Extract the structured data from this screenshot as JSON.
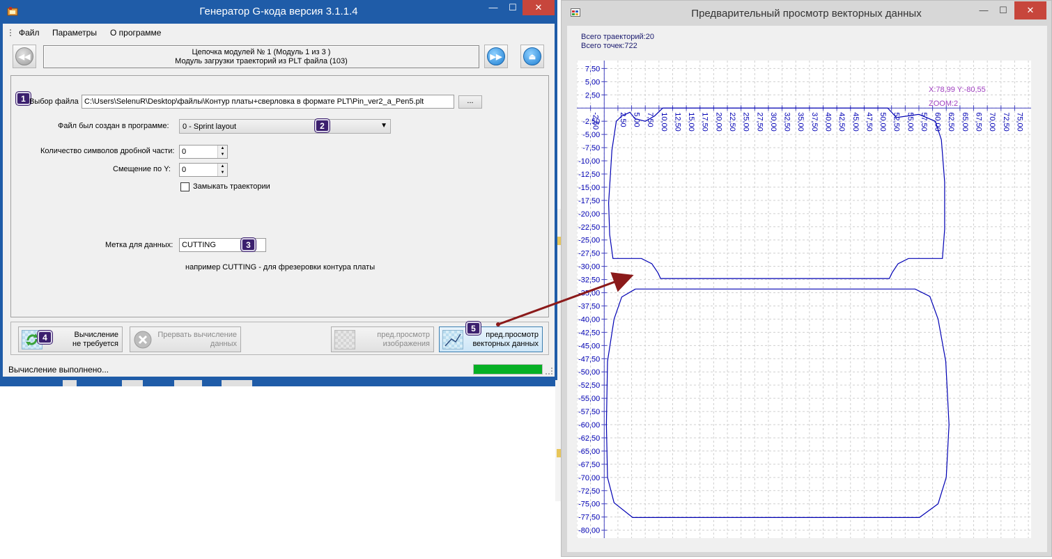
{
  "main_window": {
    "title": "Генератор G-кода версия 3.1.1.4",
    "controls": {
      "minimize": "—",
      "maximize": "☐",
      "close": "✕"
    },
    "menu": [
      "Файл",
      "Параметры",
      "О программе"
    ],
    "chain": {
      "line1": "Цепочка модулей № 1 (Модуль 1 из 3 )",
      "line2": "Модуль загрузки траекторий из PLT файла (103)"
    },
    "form": {
      "file_label": "Выбор файла",
      "file_path": "C:\\Users\\SelenuR\\Desktop\\файлы\\Контур платы+сверловка в формате PLT\\Pin_ver2_a_Pen5.plt",
      "browse_label": "...",
      "program_label": "Файл был создан в программе:",
      "program_value": "0 - Sprint layout",
      "decimals_label": "Количество символов дробной части:",
      "decimals_value": "0",
      "offset_label": "Смещение по Y:",
      "offset_value": "0",
      "close_paths_label": "Замыкать траектории",
      "close_paths_checked": false,
      "data_tag_label": "Метка для данных:",
      "data_tag_value": "CUTTING",
      "hint": "например CUTTING - для фрезеровки контура платы"
    },
    "badges": [
      "1",
      "2",
      "3",
      "4",
      "5"
    ],
    "buttons": {
      "compute": {
        "line1": "Вычисление",
        "line2": "не требуется"
      },
      "abort": {
        "line1": "Прервать вычисление",
        "line2": "данных"
      },
      "preview_image": {
        "line1": "пред.просмотр",
        "line2": "изображения"
      },
      "preview_vector": {
        "line1": "пред.просмотр",
        "line2": "векторных данных"
      }
    },
    "status": "Вычисление выполнено...",
    "progress_fraction": 1.0
  },
  "preview_window": {
    "title": "Предварительный просмотр векторных данных",
    "controls": {
      "minimize": "—",
      "maximize": "☐",
      "close": "✕"
    },
    "total_paths": "Всего траекторий:20",
    "total_points": "Всего точек:722",
    "cursor_readout": "X:78,99 Y:-80,55",
    "zoom": "ZOOM:2"
  },
  "colors": {
    "accent": "#1f5ca8",
    "plot_line": "#0000b4",
    "axis": "#4040c0",
    "badge": "#3b1f6e",
    "arrow": "#8b1a1a",
    "readout": "#a040c0"
  },
  "chart_data": {
    "type": "line",
    "x_ticks": [
      "-2,50",
      "2,50",
      "5,00",
      "7,50",
      "10,00",
      "12,50",
      "15,00",
      "17,50",
      "20,00",
      "22,50",
      "25,00",
      "27,50",
      "30,00",
      "32,50",
      "35,00",
      "37,50",
      "40,00",
      "42,50",
      "45,00",
      "47,50",
      "50,00",
      "52,50",
      "55,00",
      "57,50",
      "60,00",
      "62,50",
      "65,00",
      "67,50",
      "70,00",
      "72,50",
      "75,00"
    ],
    "y_ticks": [
      "7,50",
      "5,00",
      "2,50",
      "-2,50",
      "-5,00",
      "-7,50",
      "-10,00",
      "-12,50",
      "-15,00",
      "-17,50",
      "-20,00",
      "-22,50",
      "-25,00",
      "-27,50",
      "-30,00",
      "-32,50",
      "-35,00",
      "-37,50",
      "-40,00",
      "-42,50",
      "-45,00",
      "-47,50",
      "-50,00",
      "-52,50",
      "-55,00",
      "-57,50",
      "-60,00",
      "-62,50",
      "-65,00",
      "-67,50",
      "-70,00",
      "-72,50",
      "-75,00",
      "-77,50",
      "-80,00"
    ],
    "xlim": [
      -5,
      78
    ],
    "ylim": [
      -81.5,
      9
    ],
    "grid": true,
    "series": [
      {
        "points": [
          [
            10.7,
            0
          ],
          [
            9.2,
            -1.5
          ],
          [
            7.5,
            -2.5
          ],
          [
            5.6,
            -2
          ],
          [
            4.7,
            -0.8
          ],
          [
            3.2,
            -1.5
          ],
          [
            2.2,
            -2.5
          ],
          [
            1.4,
            -8
          ],
          [
            0.8,
            -18
          ],
          [
            1.0,
            -24
          ],
          [
            1.6,
            -28.5
          ],
          [
            6.8,
            -28.5
          ],
          [
            8.7,
            -29.5
          ],
          [
            9.8,
            -31.2
          ],
          [
            10.3,
            -32.3
          ],
          [
            52.1,
            -32.3
          ],
          [
            52.6,
            -31.2
          ],
          [
            53.7,
            -29.5
          ],
          [
            55.6,
            -28.5
          ],
          [
            61.8,
            -28.5
          ],
          [
            62.2,
            -23
          ],
          [
            62.2,
            -14
          ],
          [
            61.6,
            -6
          ],
          [
            60.5,
            -2.5
          ],
          [
            57.5,
            -1.2
          ],
          [
            53.4,
            -1.8
          ],
          [
            51.8,
            0
          ],
          [
            10.7,
            0
          ]
        ]
      },
      {
        "points": [
          [
            5.7,
            -34.3
          ],
          [
            3.2,
            -35.8
          ],
          [
            1.8,
            -40
          ],
          [
            0.6,
            -48
          ],
          [
            0.4,
            -60
          ],
          [
            0.6,
            -70
          ],
          [
            1.8,
            -74.8
          ],
          [
            5.2,
            -77.6
          ],
          [
            57.6,
            -77.6
          ],
          [
            61.0,
            -75
          ],
          [
            62.5,
            -70
          ],
          [
            63.0,
            -60
          ],
          [
            62.4,
            -48
          ],
          [
            61.0,
            -40
          ],
          [
            59.5,
            -35.7
          ],
          [
            56.8,
            -34.3
          ],
          [
            5.7,
            -34.3
          ]
        ]
      }
    ]
  }
}
